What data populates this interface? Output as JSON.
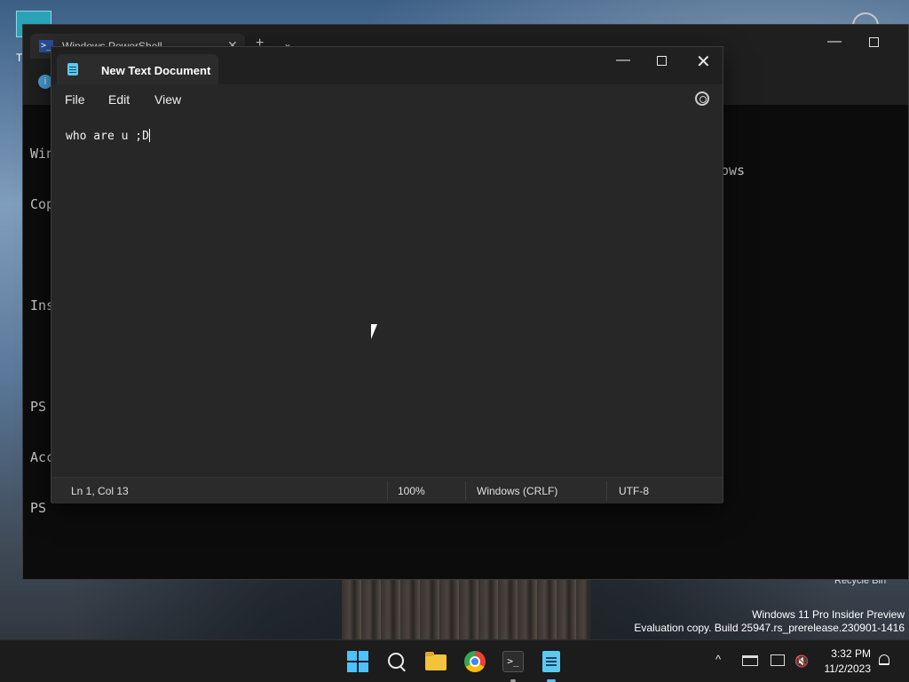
{
  "desktop": {
    "recycle_bin_label": "Recycle Bin",
    "watermark_line1": "Windows 11 Pro Insider Preview",
    "watermark_line2": "Evaluation copy. Build 25947.rs_prerelease.230901-1416",
    "icon_label": "T"
  },
  "powershell": {
    "tab_title": "Windows PowerShell",
    "tab_icon_glyph": ">_",
    "close_glyph": "✕",
    "newtab_glyph": "+",
    "dropdown_glyph": "⌄",
    "minimize_glyph": "—",
    "info_glyph": "i",
    "console_lines": [
      "Win",
      "Cop",
      "",
      "Ins",
      "",
      "PS",
      "Acc",
      "PS"
    ],
    "right_fragment": "ows"
  },
  "notepad": {
    "title": "New Text Document",
    "minimize_glyph": "—",
    "close_glyph": "✕",
    "menu": {
      "file": "File",
      "edit": "Edit",
      "view": "View"
    },
    "content": "who are u ;D",
    "status": {
      "position": "Ln 1, Col 13",
      "zoom": "100%",
      "line_ending": "Windows (CRLF)",
      "encoding": "UTF-8"
    }
  },
  "taskbar": {
    "terminal_glyph": ">_",
    "chevron_glyph": "^",
    "time": "3:32 PM",
    "date": "11/2/2023",
    "colors": {
      "accent": "#4cc2ff"
    }
  }
}
